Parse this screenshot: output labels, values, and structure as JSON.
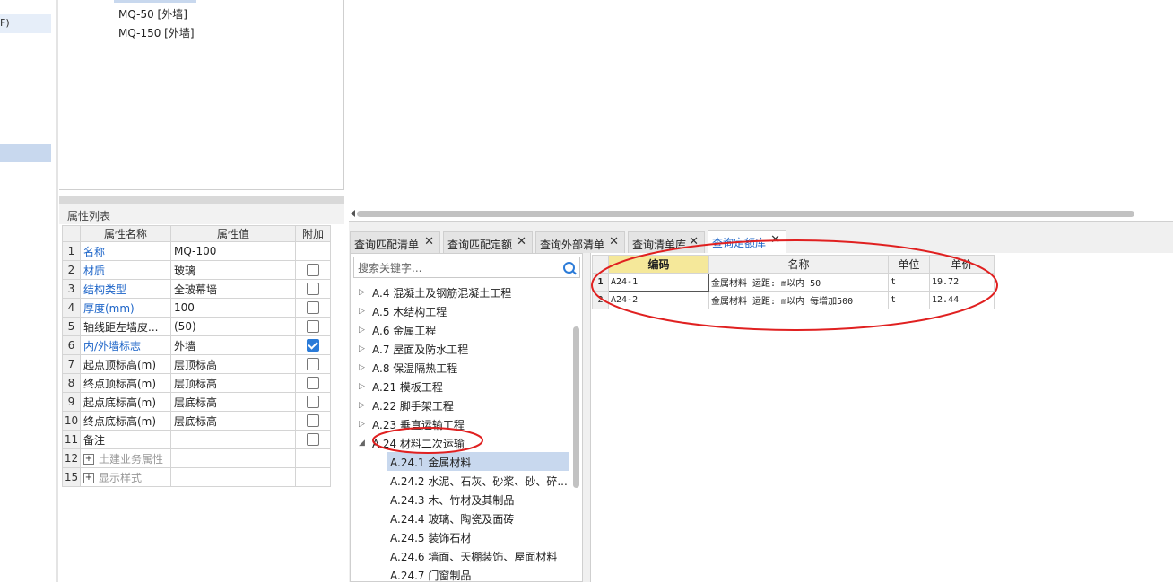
{
  "left_strip": {
    "partial_label": "F)"
  },
  "component_tree": {
    "items": [
      "MQ-50 [外墙]",
      "MQ-150 [外墙]"
    ]
  },
  "properties": {
    "title": "属性列表",
    "columns": {
      "name": "属性名称",
      "value": "属性值",
      "extra": "附加"
    },
    "rows": [
      {
        "n": "1",
        "name": "名称",
        "value": "MQ-100",
        "style": "blue",
        "checkbox": "none"
      },
      {
        "n": "2",
        "name": "材质",
        "value": "玻璃",
        "style": "blue",
        "checkbox": "off"
      },
      {
        "n": "3",
        "name": "结构类型",
        "value": "全玻幕墙",
        "style": "blue",
        "checkbox": "off"
      },
      {
        "n": "4",
        "name": "厚度(mm)",
        "value": "100",
        "style": "blue",
        "checkbox": "off"
      },
      {
        "n": "5",
        "name": "轴线距左墙皮...",
        "value": "(50)",
        "style": "normal",
        "checkbox": "off"
      },
      {
        "n": "6",
        "name": "内/外墙标志",
        "value": "外墙",
        "style": "blue",
        "checkbox": "on"
      },
      {
        "n": "7",
        "name": "起点顶标高(m)",
        "value": "层顶标高",
        "style": "normal",
        "checkbox": "off"
      },
      {
        "n": "8",
        "name": "终点顶标高(m)",
        "value": "层顶标高",
        "style": "normal",
        "checkbox": "off"
      },
      {
        "n": "9",
        "name": "起点底标高(m)",
        "value": "层底标高",
        "style": "normal",
        "checkbox": "off"
      },
      {
        "n": "10",
        "name": "终点底标高(m)",
        "value": "层底标高",
        "style": "normal",
        "checkbox": "off"
      },
      {
        "n": "11",
        "name": "备注",
        "value": "",
        "style": "normal",
        "checkbox": "off"
      },
      {
        "n": "12",
        "name": "土建业务属性",
        "value": "",
        "style": "group",
        "checkbox": "none"
      },
      {
        "n": "15",
        "name": "显示样式",
        "value": "",
        "style": "group",
        "checkbox": "none"
      }
    ]
  },
  "tabs": [
    {
      "label": "查询匹配清单",
      "closable": true,
      "active": false
    },
    {
      "label": "查询匹配定额",
      "closable": true,
      "active": false
    },
    {
      "label": "查询外部清单",
      "closable": true,
      "active": false
    },
    {
      "label": "查询清单库",
      "closable": true,
      "active": false
    },
    {
      "label": "查询定额库",
      "closable": true,
      "active": true
    }
  ],
  "search": {
    "placeholder": "搜索关键字..."
  },
  "chapters": [
    {
      "label": "A.4 混凝土及钢筋混凝土工程",
      "level": 0,
      "expanded": false
    },
    {
      "label": "A.5 木结构工程",
      "level": 0,
      "expanded": false
    },
    {
      "label": "A.6 金属工程",
      "level": 0,
      "expanded": false
    },
    {
      "label": "A.7 屋面及防水工程",
      "level": 0,
      "expanded": false
    },
    {
      "label": "A.8 保温隔热工程",
      "level": 0,
      "expanded": false
    },
    {
      "label": "A.21 模板工程",
      "level": 0,
      "expanded": false
    },
    {
      "label": "A.22 脚手架工程",
      "level": 0,
      "expanded": false
    },
    {
      "label": "A.23 垂直运输工程",
      "level": 0,
      "expanded": false
    },
    {
      "label": "A.24 材料二次运输",
      "level": 0,
      "expanded": true
    },
    {
      "label": "A.24.1 金属材料",
      "level": 1,
      "selected": true
    },
    {
      "label": "A.24.2 水泥、石灰、砂浆、砂、碎...",
      "level": 1
    },
    {
      "label": "A.24.3 木、竹材及其制品",
      "level": 1
    },
    {
      "label": "A.24.4 玻璃、陶瓷及面砖",
      "level": 1
    },
    {
      "label": "A.24.5 装饰石材",
      "level": 1
    },
    {
      "label": "A.24.6 墙面、天棚装饰、屋面材料",
      "level": 1
    },
    {
      "label": "A.24.7 门窗制品",
      "level": 1
    }
  ],
  "results": {
    "columns": {
      "code": "编码",
      "name": "名称",
      "unit": "单位",
      "price": "单价"
    },
    "rows": [
      {
        "n": "1",
        "code": "A24-1",
        "name": "金属材料 运距: m以内 50",
        "unit": "t",
        "price": "19.72"
      },
      {
        "n": "2",
        "code": "A24-2",
        "name": "金属材料 运距: m以内 每增加500",
        "unit": "t",
        "price": "12.44"
      }
    ]
  },
  "colors": {
    "accent": "#1c64c8",
    "selection": "#c8d8ee",
    "annotation": "#e02020",
    "header_highlight": "#f5e89a"
  }
}
